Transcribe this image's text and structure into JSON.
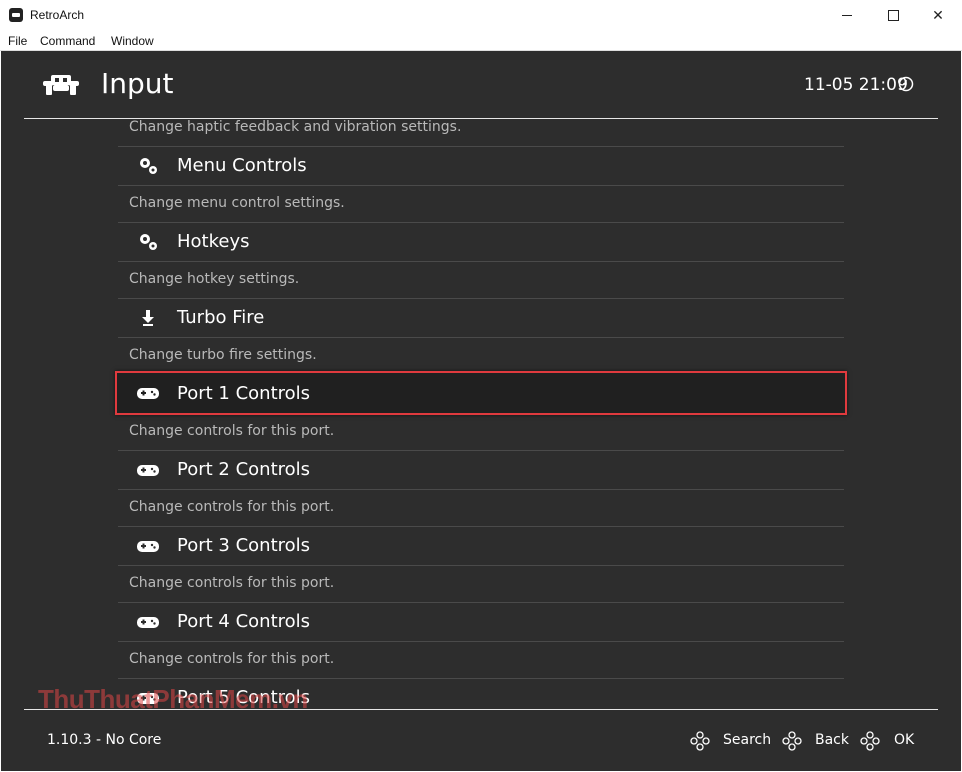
{
  "window": {
    "title": "RetroArch",
    "controls": [
      "minimize",
      "maximize",
      "close"
    ],
    "close_glyph": "✕"
  },
  "menubar": {
    "items": [
      "File",
      "Command",
      "Window"
    ]
  },
  "header": {
    "title": "Input",
    "clock": "11-05 21:09",
    "logo_icon": "retroarch-invader-icon",
    "clock_icon": "clock-icon"
  },
  "list": {
    "top_sublabel": "Change haptic feedback and vibration settings.",
    "items": [
      {
        "label": "Menu Controls",
        "sublabel": "Change menu control settings.",
        "icon": "gears-icon",
        "selected": false
      },
      {
        "label": "Hotkeys",
        "sublabel": "Change hotkey settings.",
        "icon": "gears-icon",
        "selected": false
      },
      {
        "label": "Turbo Fire",
        "sublabel": "Change turbo fire settings.",
        "icon": "download-arrow-icon",
        "selected": false
      },
      {
        "label": "Port 1 Controls",
        "sublabel": "Change controls for this port.",
        "icon": "gamepad-icon",
        "selected": true
      },
      {
        "label": "Port 2 Controls",
        "sublabel": "Change controls for this port.",
        "icon": "gamepad-icon",
        "selected": false
      },
      {
        "label": "Port 3 Controls",
        "sublabel": "Change controls for this port.",
        "icon": "gamepad-icon",
        "selected": false
      },
      {
        "label": "Port 4 Controls",
        "sublabel": "Change controls for this port.",
        "icon": "gamepad-icon",
        "selected": false
      },
      {
        "label": "Port 5 Controls",
        "icon": "gamepad-icon",
        "selected": false
      }
    ],
    "highlight_color": "#e03a3e"
  },
  "footer": {
    "version": "1.10.3 - No Core",
    "hints": [
      {
        "label": "Search",
        "icon": "dpad-buttons-icon"
      },
      {
        "label": "Back",
        "icon": "dpad-buttons-icon"
      },
      {
        "label": "OK",
        "icon": "dpad-buttons-icon"
      }
    ]
  },
  "watermark": "ThuThuatPhanMem.vn",
  "colors": {
    "background": "#2d2d2d",
    "text": "#ffffff",
    "sublabel": "#b9b9b9",
    "separator": "#4a4a4a"
  }
}
